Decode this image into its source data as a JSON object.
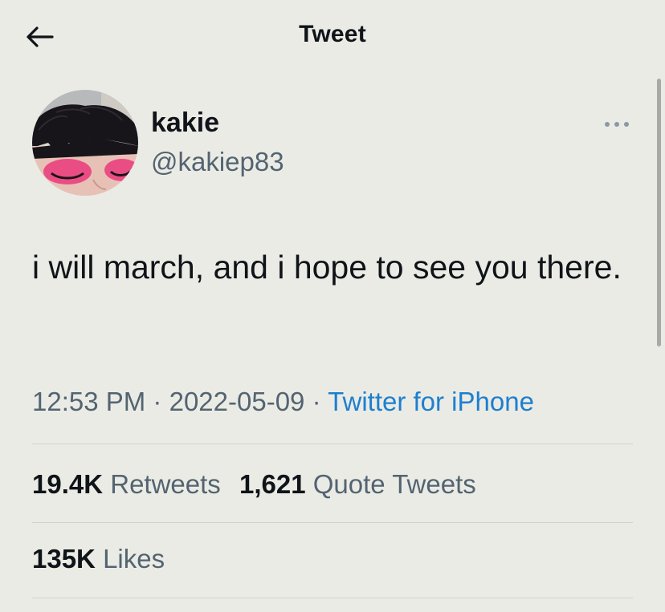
{
  "header": {
    "title": "Tweet",
    "back_icon": "arrow-left-icon"
  },
  "author": {
    "display_name": "kakie",
    "handle": "@kakiep83",
    "avatar": "avatar-photo",
    "more_icon": "more-horizontal-icon"
  },
  "tweet": {
    "text": "i will march, and i hope to see you there.",
    "time": "12:53 PM",
    "date": "2022-05-09",
    "separator": "·",
    "source": "Twitter for iPhone"
  },
  "stats": {
    "retweets_count": "19.4K",
    "retweets_label": "Retweets",
    "quotes_count": "1,621",
    "quotes_label": "Quote Tweets",
    "likes_count": "135K",
    "likes_label": "Likes"
  },
  "colors": {
    "background": "#ebebe5",
    "primary_text": "#0f1419",
    "secondary_text": "#536471",
    "link": "#1d7fcf",
    "divider": "#cfd2d2"
  }
}
